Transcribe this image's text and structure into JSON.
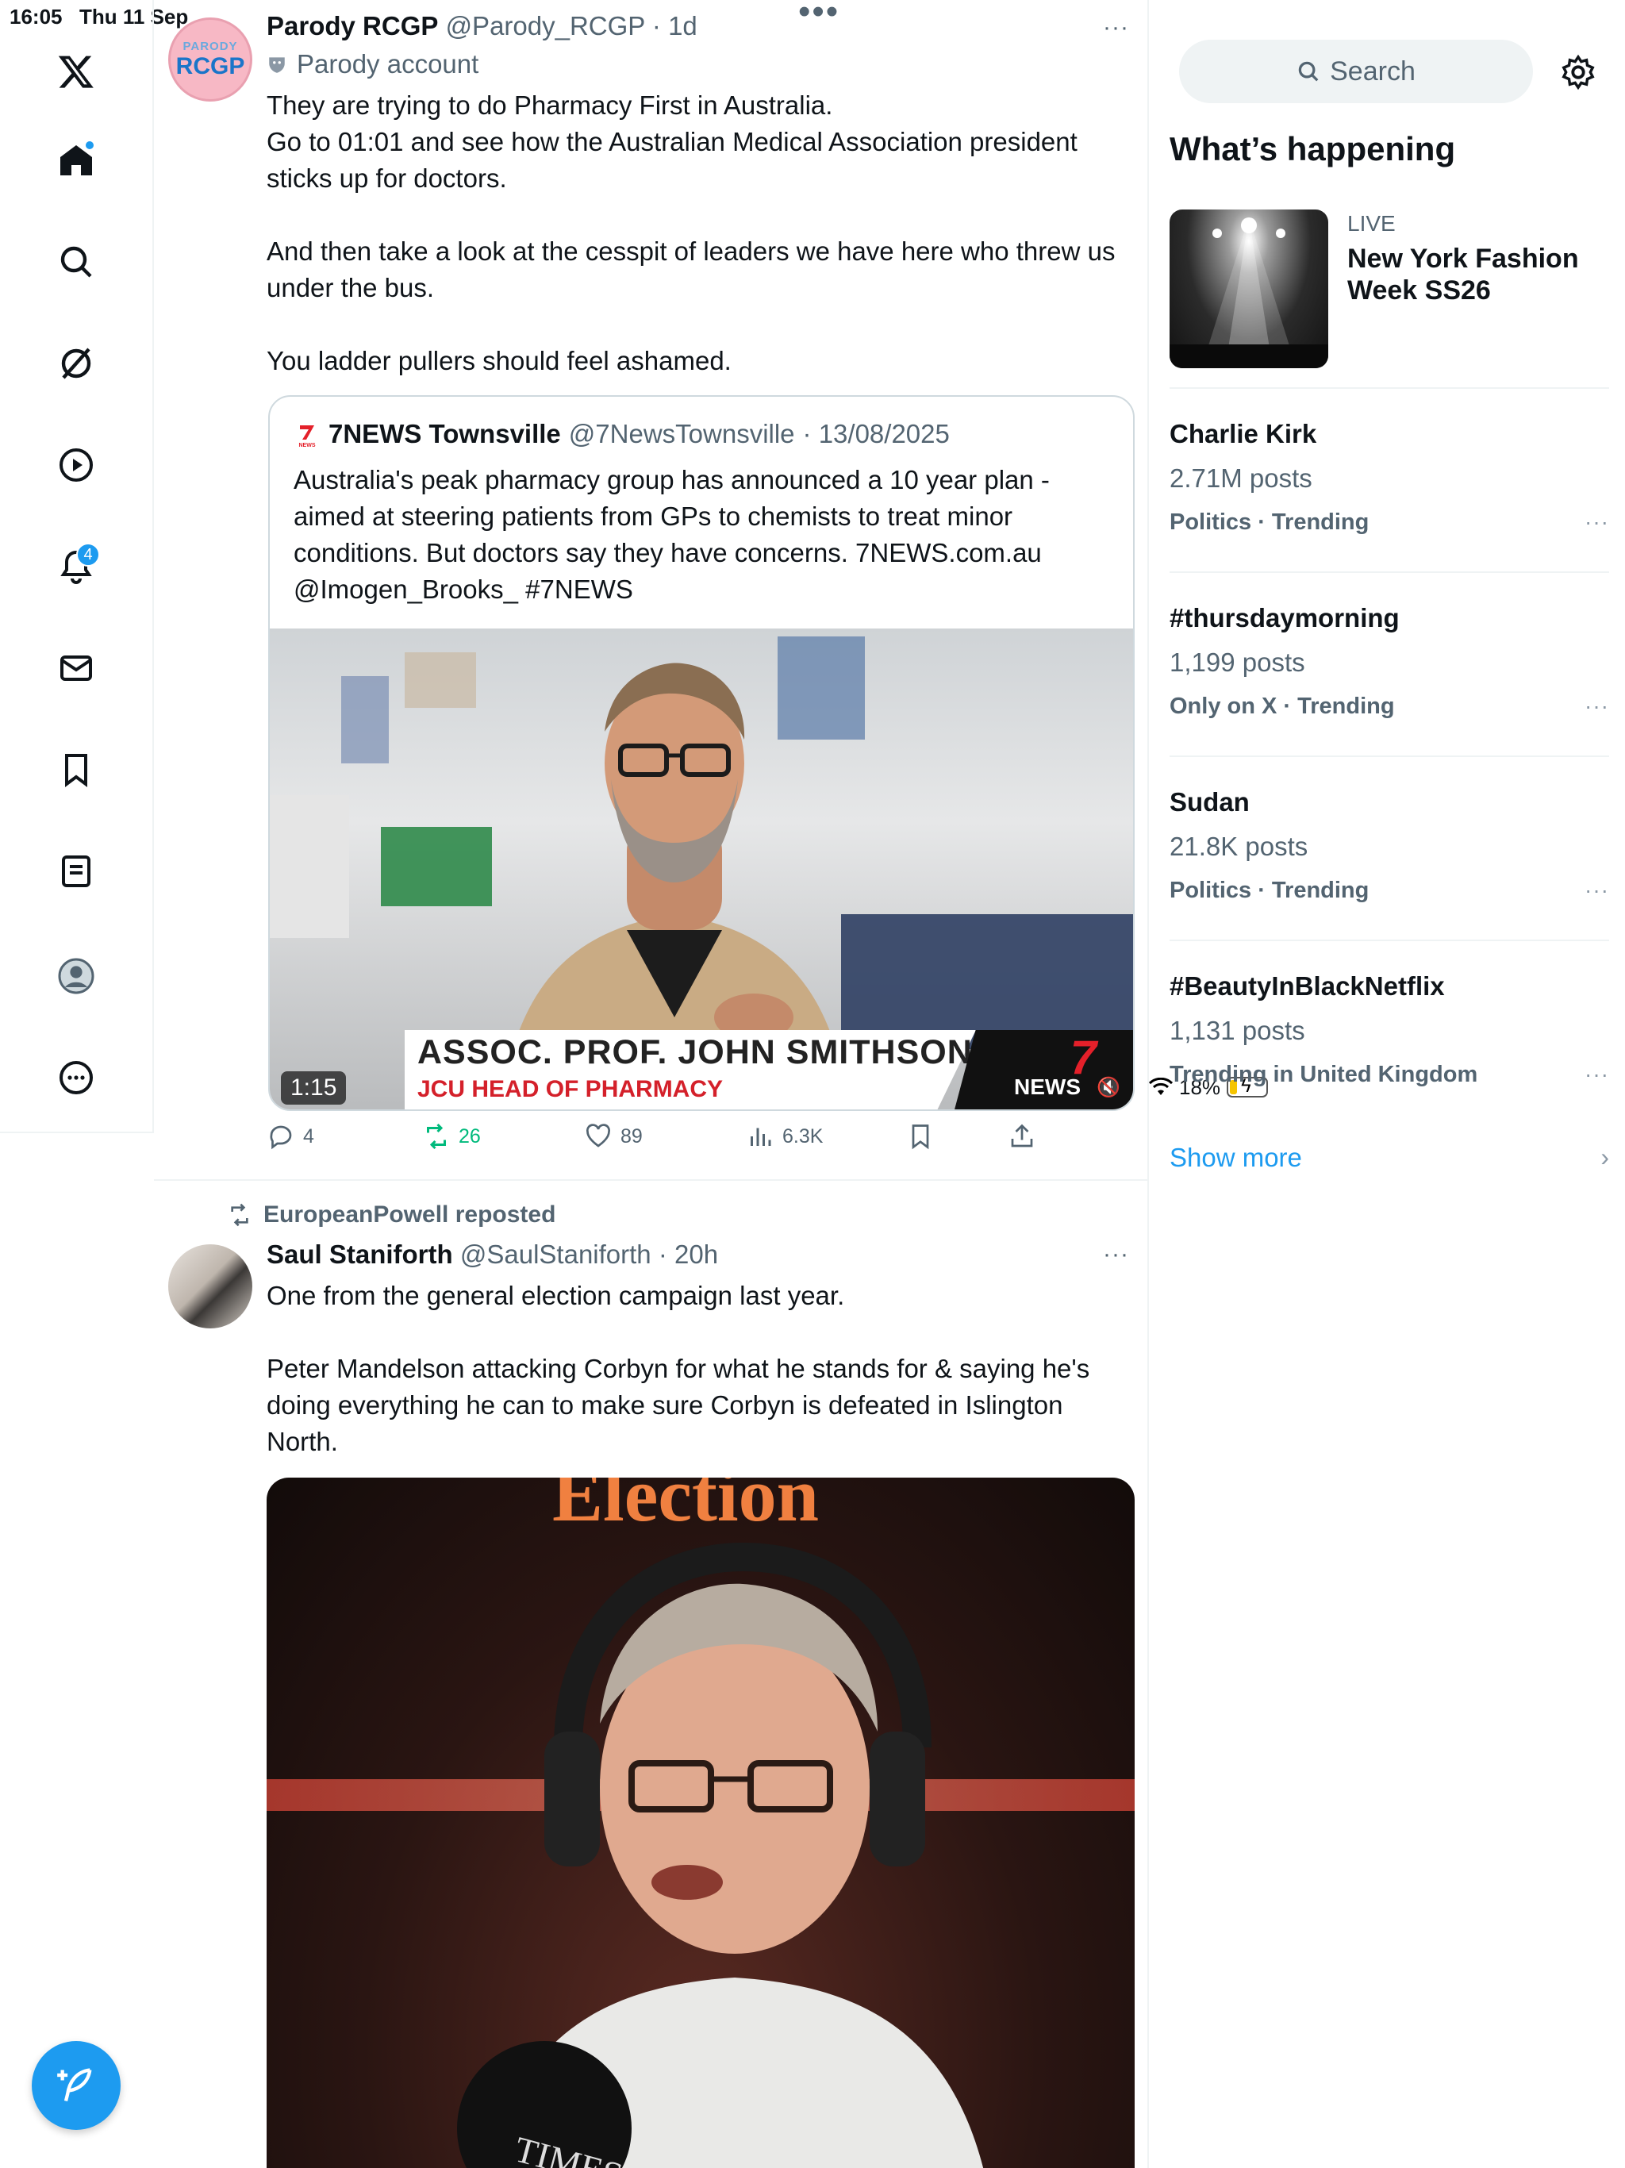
{
  "status_bar": {
    "time": "16:05",
    "date": "Thu 11 Sep",
    "battery": "18%"
  },
  "nav": {
    "notifications_badge": "4"
  },
  "feed": {
    "tweet1": {
      "name": "Parody RCGP",
      "handle": "@Parody_RCGP",
      "age": "· 1d",
      "parody_label": "Parody account",
      "avatar_text_top": "PARODY",
      "avatar_text_main": "RCGP",
      "text": "They are trying to do Pharmacy First in Australia.\nGo to 01:01 and see how the Australian Medical Association president sticks up for doctors.\n\nAnd then take a look at the cesspit of leaders we have here who threw us under the bus.\n\nYou ladder pullers should feel ashamed.",
      "quote": {
        "name": "7NEWS Townsville",
        "handle": "@7NewsTownsville",
        "date": "· 13/08/2025",
        "text": "Australia's peak pharmacy group has announced a 10 year plan - aimed at steering patients from GPs to chemists to treat minor conditions. But doctors say they have concerns. 7NEWS.com.au @Imogen_Brooks_ #7NEWS",
        "video_name": "ASSOC. PROF. JOHN SMITHSON",
        "video_role": "JCU HEAD OF PHARMACY",
        "video_brand_num": "7",
        "video_brand": "NEWS",
        "duration": "1:15"
      },
      "stats": {
        "replies": "4",
        "reposts": "26",
        "likes": "89",
        "views": "6.3K"
      }
    },
    "tweet2": {
      "reposted_by": "EuropeanPowell reposted",
      "name": "Saul Staniforth",
      "handle": "@SaulStaniforth",
      "age": "· 20h",
      "text": "One from the general election campaign last year.\n\nPeter Mandelson attacking Corbyn for what he stands for & saying he's doing everything he can to make sure Corbyn is defeated in Islington North.",
      "video_overlay_text": "Election",
      "mic_text": "TIMES"
    }
  },
  "sidebar": {
    "search_placeholder": "Search",
    "heading": "What’s happening",
    "live": {
      "label": "LIVE",
      "title": "New York Fashion Week SS26"
    },
    "trends": [
      {
        "name": "Charlie Kirk",
        "posts": "2.71M posts",
        "category": "Politics · Trending"
      },
      {
        "name": "#thursdaymorning",
        "posts": "1,199 posts",
        "category": "Only on X · Trending"
      },
      {
        "name": "Sudan",
        "posts": "21.8K posts",
        "category": "Politics · Trending"
      },
      {
        "name": "#BeautyInBlackNetflix",
        "posts": "1,131 posts",
        "category": "Trending in United Kingdom"
      }
    ],
    "show_more": "Show more"
  },
  "colors": {
    "accent": "#1d9bf0",
    "text": "#0f1419",
    "muted": "#536471",
    "repost_green": "#00ba7c",
    "news_red": "#d4202a"
  }
}
